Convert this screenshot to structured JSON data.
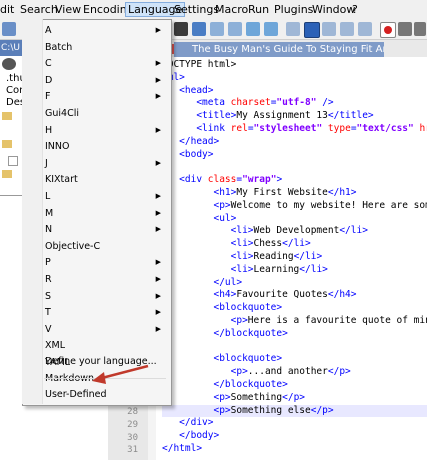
{
  "menubar": [
    "dit",
    "Search",
    "View",
    "Encoding",
    "Language",
    "Settings",
    "Macro",
    "Run",
    "Plugins",
    "Window",
    "?"
  ],
  "left_panel": {
    "tab_label": "C:\\U",
    "lines": [
      ".thu",
      "Conf",
      "Desk"
    ]
  },
  "editor": {
    "doc_tab": "The Busy Man's Guide To Staying Fit And Healthy.md",
    "gutter_numbers": [
      "28",
      "29",
      "30",
      "31"
    ]
  },
  "code_lines": [
    [
      {
        "c": "txt",
        "t": "DOCTYPE html>"
      }
    ],
    [
      {
        "c": "tag",
        "t": "tml>"
      }
    ],
    [
      {
        "c": "tag",
        "t": "   <head>"
      }
    ],
    [
      {
        "c": "tag",
        "t": "      <meta "
      },
      {
        "c": "attr",
        "t": "charset"
      },
      {
        "c": "tag",
        "t": "="
      },
      {
        "c": "str",
        "t": "\"utf-8\""
      },
      {
        "c": "tag",
        "t": " />"
      }
    ],
    [
      {
        "c": "tag",
        "t": "      <title>"
      },
      {
        "c": "txt",
        "t": "My Assignment 13"
      },
      {
        "c": "tag",
        "t": "</title>"
      }
    ],
    [
      {
        "c": "tag",
        "t": "      <link "
      },
      {
        "c": "attr",
        "t": "rel"
      },
      {
        "c": "tag",
        "t": "="
      },
      {
        "c": "str",
        "t": "\"stylesheet\""
      },
      {
        "c": "tag",
        "t": " "
      },
      {
        "c": "attr",
        "t": "type"
      },
      {
        "c": "tag",
        "t": "="
      },
      {
        "c": "str",
        "t": "\"text/css\""
      },
      {
        "c": "tag",
        "t": " "
      },
      {
        "c": "attr",
        "t": "href"
      }
    ],
    [
      {
        "c": "tag",
        "t": "   </head>"
      }
    ],
    [
      {
        "c": "tag",
        "t": "   <body>"
      }
    ],
    [
      {
        "c": "txt",
        "t": ""
      }
    ],
    [
      {
        "c": "tag",
        "t": "   <div "
      },
      {
        "c": "attr",
        "t": "class"
      },
      {
        "c": "tag",
        "t": "="
      },
      {
        "c": "str",
        "t": "\"wrap\""
      },
      {
        "c": "tag",
        "t": ">"
      }
    ],
    [
      {
        "c": "tag",
        "t": "         <h1>"
      },
      {
        "c": "txt",
        "t": "My First Website"
      },
      {
        "c": "tag",
        "t": "</h1>"
      }
    ],
    [
      {
        "c": "tag",
        "t": "         <p>"
      },
      {
        "c": "txt",
        "t": "Welcome to my website! Here are some"
      }
    ],
    [
      {
        "c": "tag",
        "t": "         <ul>"
      }
    ],
    [
      {
        "c": "tag",
        "t": "            <li>"
      },
      {
        "c": "txt",
        "t": "Web Development"
      },
      {
        "c": "tag",
        "t": "</li>"
      }
    ],
    [
      {
        "c": "tag",
        "t": "            <li>"
      },
      {
        "c": "txt",
        "t": "Chess"
      },
      {
        "c": "tag",
        "t": "</li>"
      }
    ],
    [
      {
        "c": "tag",
        "t": "            <li>"
      },
      {
        "c": "txt",
        "t": "Reading"
      },
      {
        "c": "tag",
        "t": "</li>"
      }
    ],
    [
      {
        "c": "tag",
        "t": "            <li>"
      },
      {
        "c": "txt",
        "t": "Learning"
      },
      {
        "c": "tag",
        "t": "</li>"
      }
    ],
    [
      {
        "c": "tag",
        "t": "         </ul>"
      }
    ],
    [
      {
        "c": "tag",
        "t": "         <h4>"
      },
      {
        "c": "txt",
        "t": "Favourite Quotes"
      },
      {
        "c": "tag",
        "t": "</h4>"
      }
    ],
    [
      {
        "c": "tag",
        "t": "         <blockquote>"
      }
    ],
    [
      {
        "c": "tag",
        "t": "            <p>"
      },
      {
        "c": "txt",
        "t": "Here is a favourite quote of min"
      }
    ],
    [
      {
        "c": "tag",
        "t": "         </blockquote>"
      }
    ],
    [
      {
        "c": "txt",
        "t": ""
      }
    ],
    [
      {
        "c": "tag",
        "t": "         <blockquote>"
      }
    ],
    [
      {
        "c": "tag",
        "t": "            <p>"
      },
      {
        "c": "txt",
        "t": "...and another"
      },
      {
        "c": "tag",
        "t": "</p>"
      }
    ],
    [
      {
        "c": "tag",
        "t": "         </blockquote>"
      }
    ],
    [
      {
        "c": "tag",
        "t": "         <p>"
      },
      {
        "c": "txt",
        "t": "Something"
      },
      {
        "c": "tag",
        "t": "</p>"
      }
    ],
    [
      {
        "c": "tag",
        "t": "         <p>"
      },
      {
        "c": "txt",
        "t": "Something else"
      },
      {
        "c": "tag",
        "t": "</p>"
      }
    ],
    [
      {
        "c": "tag",
        "t": "   </div>"
      }
    ],
    [
      {
        "c": "tag",
        "t": "   </body>"
      }
    ],
    [
      {
        "c": "tag",
        "t": "</html>"
      }
    ]
  ],
  "language_menu": {
    "items": [
      {
        "label": "A",
        "sub": true
      },
      {
        "label": "Batch",
        "sub": false
      },
      {
        "label": "C",
        "sub": true
      },
      {
        "label": "D",
        "sub": true
      },
      {
        "label": "F",
        "sub": true
      },
      {
        "label": "Gui4Cli",
        "sub": false
      },
      {
        "label": "H",
        "sub": true
      },
      {
        "label": "INNO",
        "sub": false
      },
      {
        "label": "J",
        "sub": true
      },
      {
        "label": "KIXtart",
        "sub": false
      },
      {
        "label": "L",
        "sub": true
      },
      {
        "label": "M",
        "sub": true
      },
      {
        "label": "N",
        "sub": true
      },
      {
        "label": "Objective-C",
        "sub": false
      },
      {
        "label": "P",
        "sub": true
      },
      {
        "label": "R",
        "sub": true
      },
      {
        "label": "S",
        "sub": true
      },
      {
        "label": "T",
        "sub": true
      },
      {
        "label": "V",
        "sub": true
      },
      {
        "label": "XML",
        "sub": false
      },
      {
        "label": "YAML",
        "sub": false
      }
    ],
    "extra": [
      "Define your language...",
      "Markdown",
      "User-Defined"
    ]
  },
  "colors": {
    "annotation_arrow": "#c0392b",
    "menu_highlight": "#cfe3f8"
  }
}
